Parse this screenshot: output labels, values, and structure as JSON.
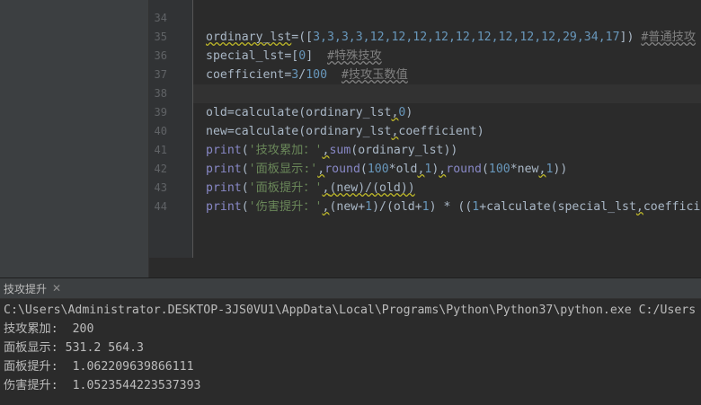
{
  "editor": {
    "lines": [
      {
        "n": "34"
      },
      {
        "n": "35"
      },
      {
        "n": "36"
      },
      {
        "n": "37"
      },
      {
        "n": "38"
      },
      {
        "n": "39"
      },
      {
        "n": "40"
      },
      {
        "n": "41"
      },
      {
        "n": "42"
      },
      {
        "n": "43"
      },
      {
        "n": "44"
      }
    ],
    "code": {
      "l35_a": "ordinary_lst",
      "l35_b": "=([",
      "l35_nums": "3,3,3,3,12,12,12,12,12,12,12,12,12,29,34,17",
      "l35_c": "]) ",
      "l35_comment": "#普通技攻",
      "l36_a": "special_lst",
      "l36_b": "=[",
      "l36_num": "0",
      "l36_c": "]  ",
      "l36_comment": "#特殊技攻",
      "l37_a": "coefficient",
      "l37_b": "=",
      "l37_n1": "3",
      "l37_c": "/",
      "l37_n2": "100",
      "l37_d": "  ",
      "l37_comment": "#技攻玉数值",
      "l39_a": "old",
      "l39_b": "=calculate(ordinary_lst",
      "l39_comma": ",",
      "l39_num": "0",
      "l39_c": ")",
      "l40_a": "new",
      "l40_b": "=calculate(ordinary_lst",
      "l40_comma": ",",
      "l40_c": "coefficient)",
      "l41_print": "print",
      "l41_a": "(",
      "l41_str": "'技攻累加：'",
      "l41_comma": ",",
      "l41_sum": "sum",
      "l41_b": "(ordinary_lst))",
      "l42_print": "print",
      "l42_a": "(",
      "l42_str": "'面板显示:'",
      "l42_comma1": ",",
      "l42_round1": "round",
      "l42_b": "(",
      "l42_n1": "100",
      "l42_c": "*old",
      "l42_comma2": ",",
      "l42_n2": "1",
      "l42_d": ")",
      "l42_comma3": ",",
      "l42_round2": "round",
      "l42_e": "(",
      "l42_n3": "100",
      "l42_f": "*new",
      "l42_comma4": ",",
      "l42_n4": "1",
      "l42_g": "))",
      "l43_print": "print",
      "l43_a": "(",
      "l43_str": "'面板提升：'",
      "l43_comma": ",",
      "l43_b": "(new)/(old))",
      "l44_print": "print",
      "l44_a": "(",
      "l44_str": "'伤害提升：'",
      "l44_comma": ",",
      "l44_b": "(new+",
      "l44_n1": "1",
      "l44_c": ")/(old+",
      "l44_n2": "1",
      "l44_d": ") * ((",
      "l44_n3": "1",
      "l44_e": "+calculate(special_lst",
      "l44_comma2": ",",
      "l44_f": "coeffici"
    }
  },
  "run_panel": {
    "tab_label": "技攻提升",
    "output": [
      "C:\\Users\\Administrator.DESKTOP-3JS0VU1\\AppData\\Local\\Programs\\Python\\Python37\\python.exe C:/Users",
      "技攻累加:  200",
      "面板显示: 531.2 564.3",
      "面板提升:  1.062209639866111",
      "伤害提升:  1.0523544223537393"
    ]
  },
  "colors": {
    "background": "#2b2b2b",
    "gutter": "#313335",
    "number": "#6897bb",
    "string": "#6a8759",
    "comment": "#808080",
    "builtin": "#8888c6",
    "text": "#a9b7c6"
  }
}
